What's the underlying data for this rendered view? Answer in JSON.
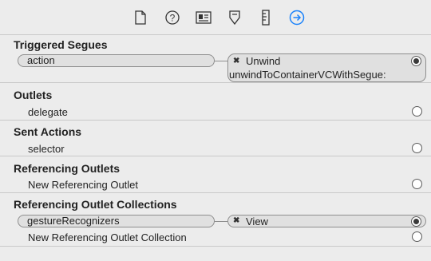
{
  "toolbar": {
    "icons": [
      "file-inspector-icon",
      "quick-help-icon",
      "identity-inspector-icon",
      "attributes-inspector-icon",
      "size-inspector-icon",
      "connections-inspector-icon"
    ],
    "active_color": "#1a82fb"
  },
  "sections": {
    "triggered_segues": {
      "title": "Triggered Segues",
      "source": "action",
      "target_line1": "Unwind",
      "target_line2": "unwindToContainerVCWithSegue:"
    },
    "outlets": {
      "title": "Outlets",
      "row": "delegate"
    },
    "sent_actions": {
      "title": "Sent Actions",
      "row": "selector"
    },
    "referencing_outlets": {
      "title": "Referencing Outlets",
      "row": "New Referencing Outlet"
    },
    "referencing_outlet_collections": {
      "title": "Referencing Outlet Collections",
      "source": "gestureRecognizers",
      "target": "View",
      "row": "New Referencing Outlet Collection"
    }
  }
}
